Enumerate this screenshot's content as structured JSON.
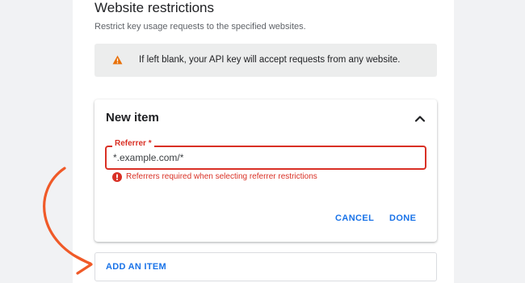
{
  "section": {
    "title": "Website restrictions",
    "description": "Restrict key usage requests to the specified websites."
  },
  "warning": {
    "icon": "warning-triangle-icon",
    "text": "If left blank, your API key will accept requests from any website.",
    "color": "#e8710a"
  },
  "card": {
    "title": "New item",
    "collapse_icon": "chevron-up-icon",
    "field": {
      "label": "Referrer *",
      "value": "*.example.com/*"
    },
    "error": {
      "icon": "error-circle-icon",
      "text": "Referrers required when selecting referrer restrictions",
      "color": "#d93025"
    },
    "cancel_label": "CANCEL",
    "done_label": "DONE"
  },
  "add_item": {
    "label": "ADD AN ITEM"
  },
  "annotation": {
    "arrow_color": "#f05a28"
  },
  "colors": {
    "accent": "#1a73e8",
    "error": "#d93025"
  }
}
